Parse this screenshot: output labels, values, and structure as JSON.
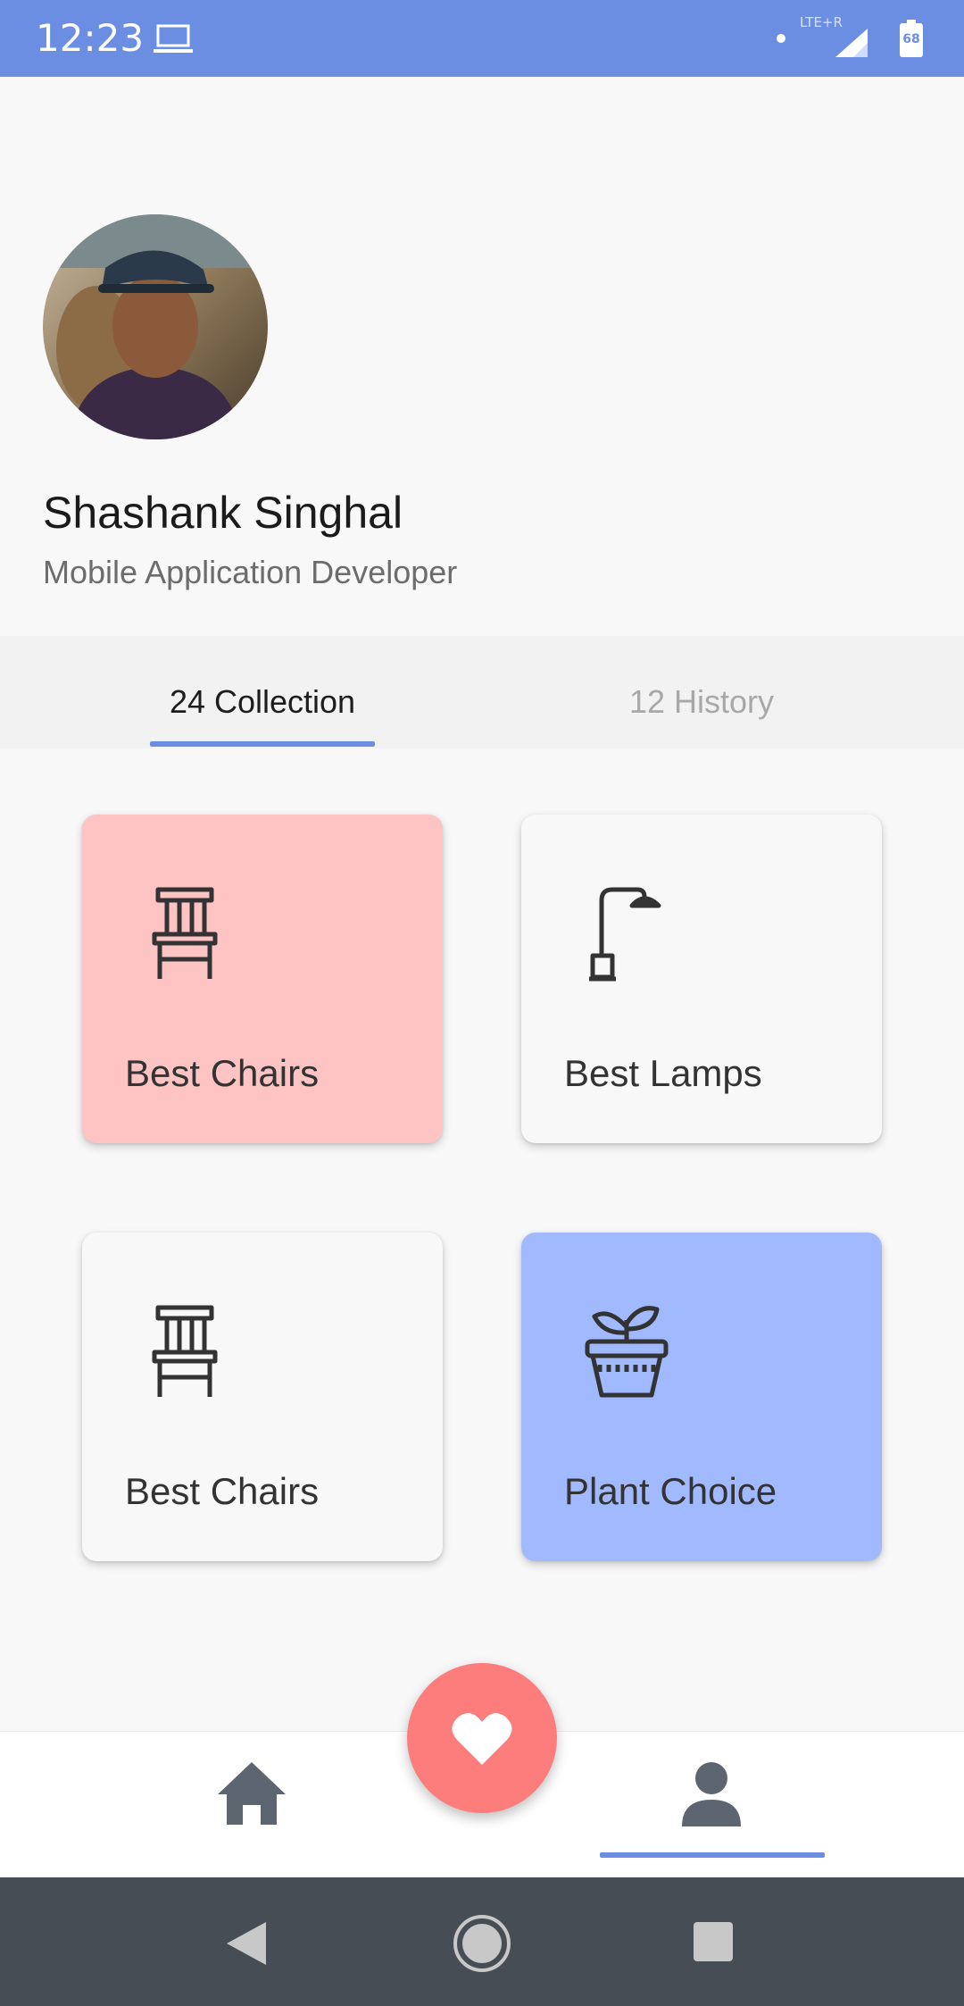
{
  "status_bar": {
    "time": "12:23",
    "network_label": "LTE+R",
    "battery_level": "68",
    "icons": [
      "laptop-icon",
      "notification-dot-icon",
      "signal-icon",
      "battery-icon"
    ]
  },
  "profile": {
    "name": "Shashank Singhal",
    "role": "Mobile Application Developer",
    "avatar_icon": "avatar-photo"
  },
  "tabs": [
    {
      "label": "24 Collection",
      "active": true
    },
    {
      "label": "12 History",
      "active": false
    }
  ],
  "cards": [
    {
      "label": "Best Chairs",
      "icon": "chair-icon",
      "color": "#fec3c3"
    },
    {
      "label": "Best Lamps",
      "icon": "lamp-icon",
      "color": "#f8f8f8"
    },
    {
      "label": "Best Chairs",
      "icon": "chair-icon",
      "color": "#f8f8f8"
    },
    {
      "label": "Plant Choice",
      "icon": "plant-icon",
      "color": "#a1b9ff"
    }
  ],
  "bottom_nav": {
    "items": [
      "home-icon",
      "profile-icon"
    ],
    "active": "profile-icon",
    "fab_icon": "heart-icon"
  },
  "system_nav": [
    "back-icon",
    "home-circle-icon",
    "recents-icon"
  ],
  "colors": {
    "accent": "#6b8ee3",
    "fab": "#fd7c7c",
    "card_pink": "#fec3c3",
    "card_blue": "#a1b9ff",
    "system_nav": "#474d54"
  }
}
